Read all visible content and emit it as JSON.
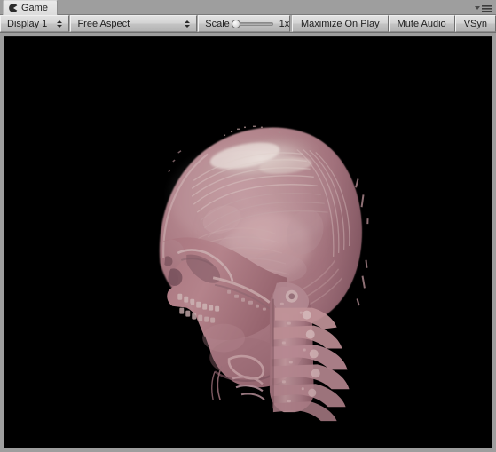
{
  "window": {
    "tab": {
      "label": "Game",
      "icon": "game-pacman-icon"
    },
    "panel_menu_icon": "panel-options-menu-icon"
  },
  "toolbar": {
    "display_dropdown": {
      "value": "Display 1",
      "icon": "chevron-updown-icon"
    },
    "aspect_dropdown": {
      "value": "Free Aspect",
      "icon": "chevron-updown-icon"
    },
    "scale": {
      "label": "Scale",
      "value": "1x",
      "slider_position_pct": 0
    },
    "buttons": [
      {
        "label": "Maximize On Play",
        "active": false
      },
      {
        "label": "Mute Audio",
        "active": false
      },
      {
        "label": "VSyn",
        "active": false
      }
    ]
  },
  "gameview": {
    "background_color": "#000000",
    "content_description": "volume-rendered-ct-skull",
    "colors": {
      "bone_mid": "#b0848c",
      "bone_dark": "#8d5f68",
      "bone_light": "#cfb2b4",
      "highlight": "#ded0cd",
      "deep_shadow": "#6d474f",
      "vertebra": "#b98e94"
    }
  }
}
